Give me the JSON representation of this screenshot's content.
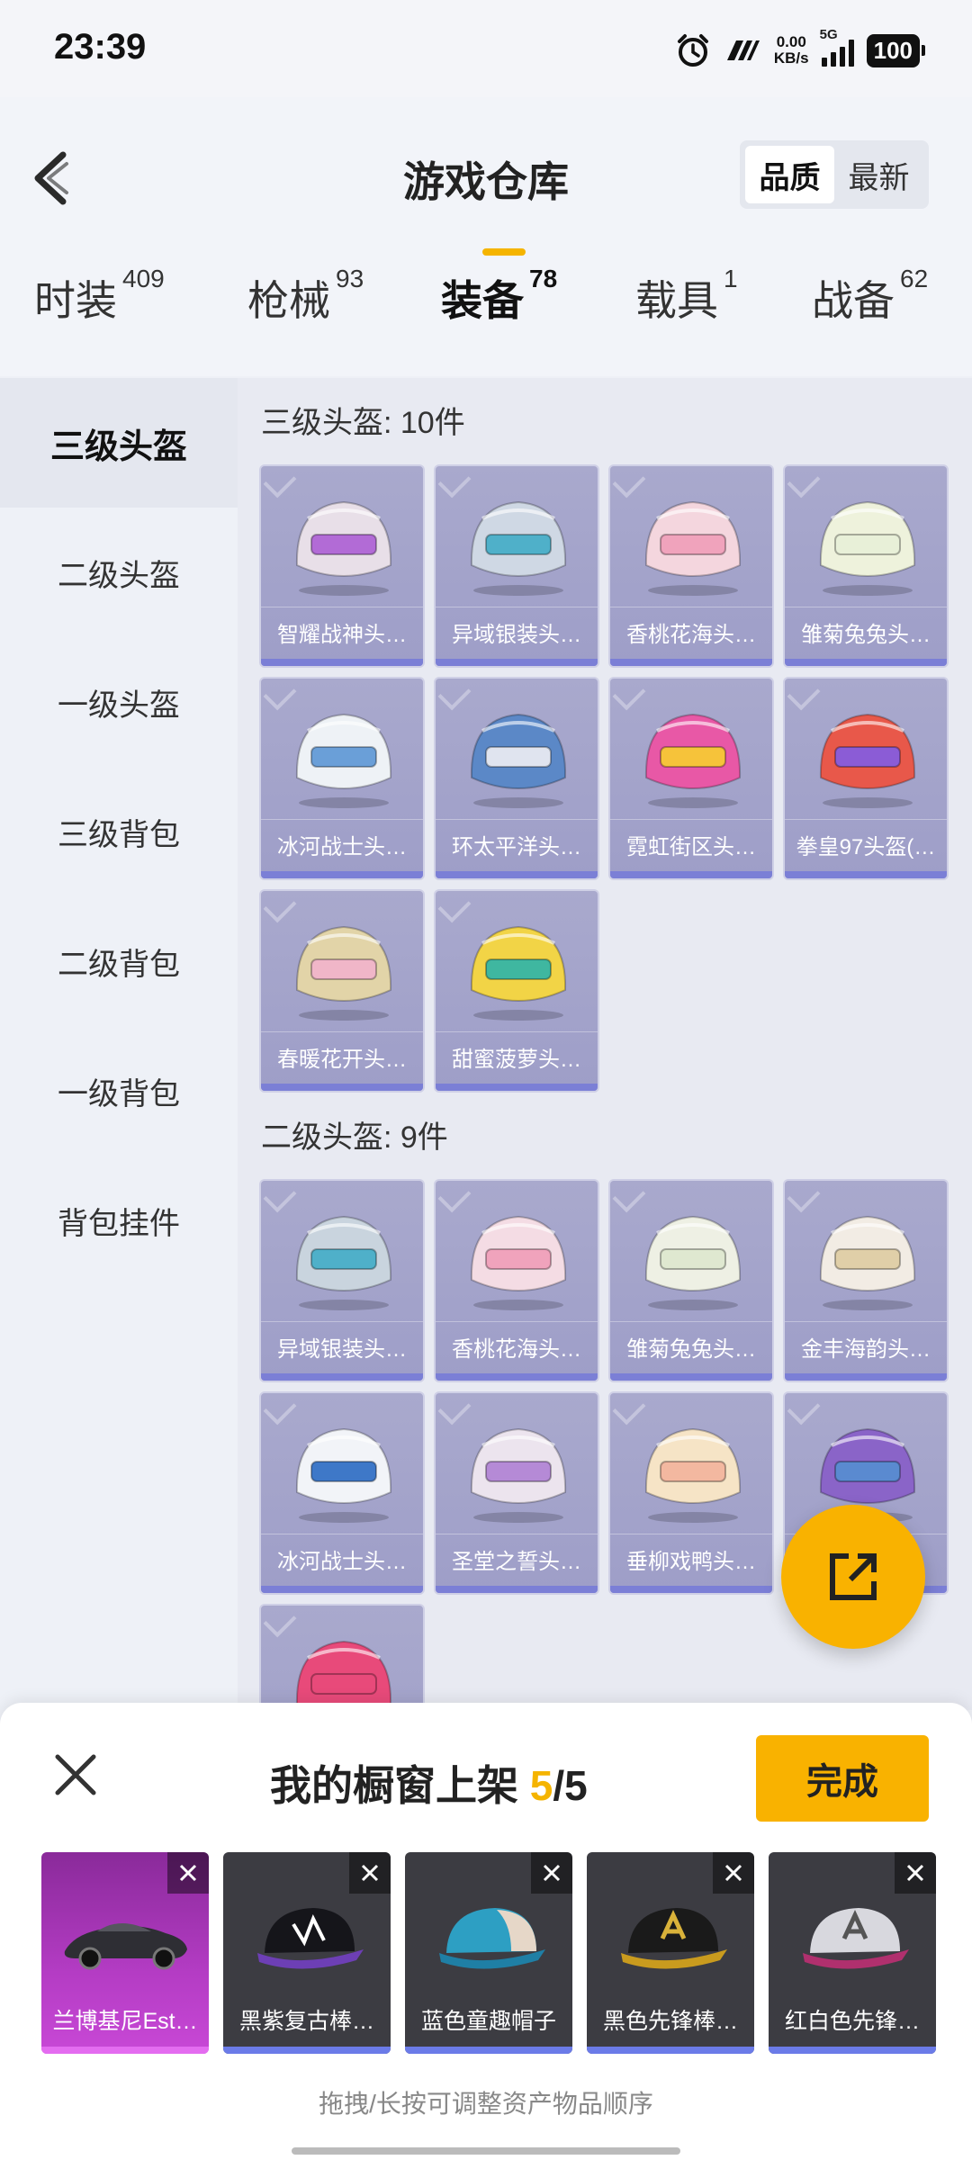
{
  "status_bar": {
    "time": "23:39",
    "net_speed": "0.00",
    "net_unit": "KB/s",
    "network": "5G",
    "battery": "100"
  },
  "header": {
    "title": "游戏仓库",
    "sort_options": [
      "品质",
      "最新"
    ],
    "sort_selected": "品质"
  },
  "tabs": [
    {
      "label": "时装",
      "count": "409"
    },
    {
      "label": "枪械",
      "count": "93"
    },
    {
      "label": "装备",
      "count": "78"
    },
    {
      "label": "载具",
      "count": "1"
    },
    {
      "label": "战备",
      "count": "62"
    }
  ],
  "active_tab": "装备",
  "sidebar": {
    "items": [
      "三级头盔",
      "二级头盔",
      "一级头盔",
      "三级背包",
      "二级背包",
      "一级背包",
      "背包挂件"
    ],
    "active": "三级头盔"
  },
  "sections": [
    {
      "title": "三级头盔: 10件",
      "items": [
        "智耀战神头…",
        "异域银装头…",
        "香桃花海头…",
        "雏菊兔兔头…",
        "冰河战士头…",
        "环太平洋头…",
        "霓虹街区头…",
        "拳皇97头盔(…",
        "春暖花开头…",
        "甜蜜菠萝头…"
      ]
    },
    {
      "title": "二级头盔: 9件",
      "items": [
        "异域银装头…",
        "香桃花海头…",
        "雏菊兔兔头…",
        "金丰海韵头…",
        "冰河战士头…",
        "圣堂之誓头…",
        "垂柳戏鸭头…",
        "",
        ""
      ]
    }
  ],
  "showcase": {
    "title_prefix": "我的橱窗上架",
    "count": "5",
    "total": "/5",
    "done_label": "完成",
    "items": [
      "兰博基尼Est…",
      "黑紫复古棒…",
      "蓝色童趣帽子",
      "黑色先锋棒…",
      "红白色先锋…"
    ],
    "hint": "拖拽/长按可调整资产物品顺序"
  },
  "colors": {
    "accent": "#f9b200",
    "card_bg": "#a9a9cd",
    "card_bar": "#7b7fd6"
  }
}
